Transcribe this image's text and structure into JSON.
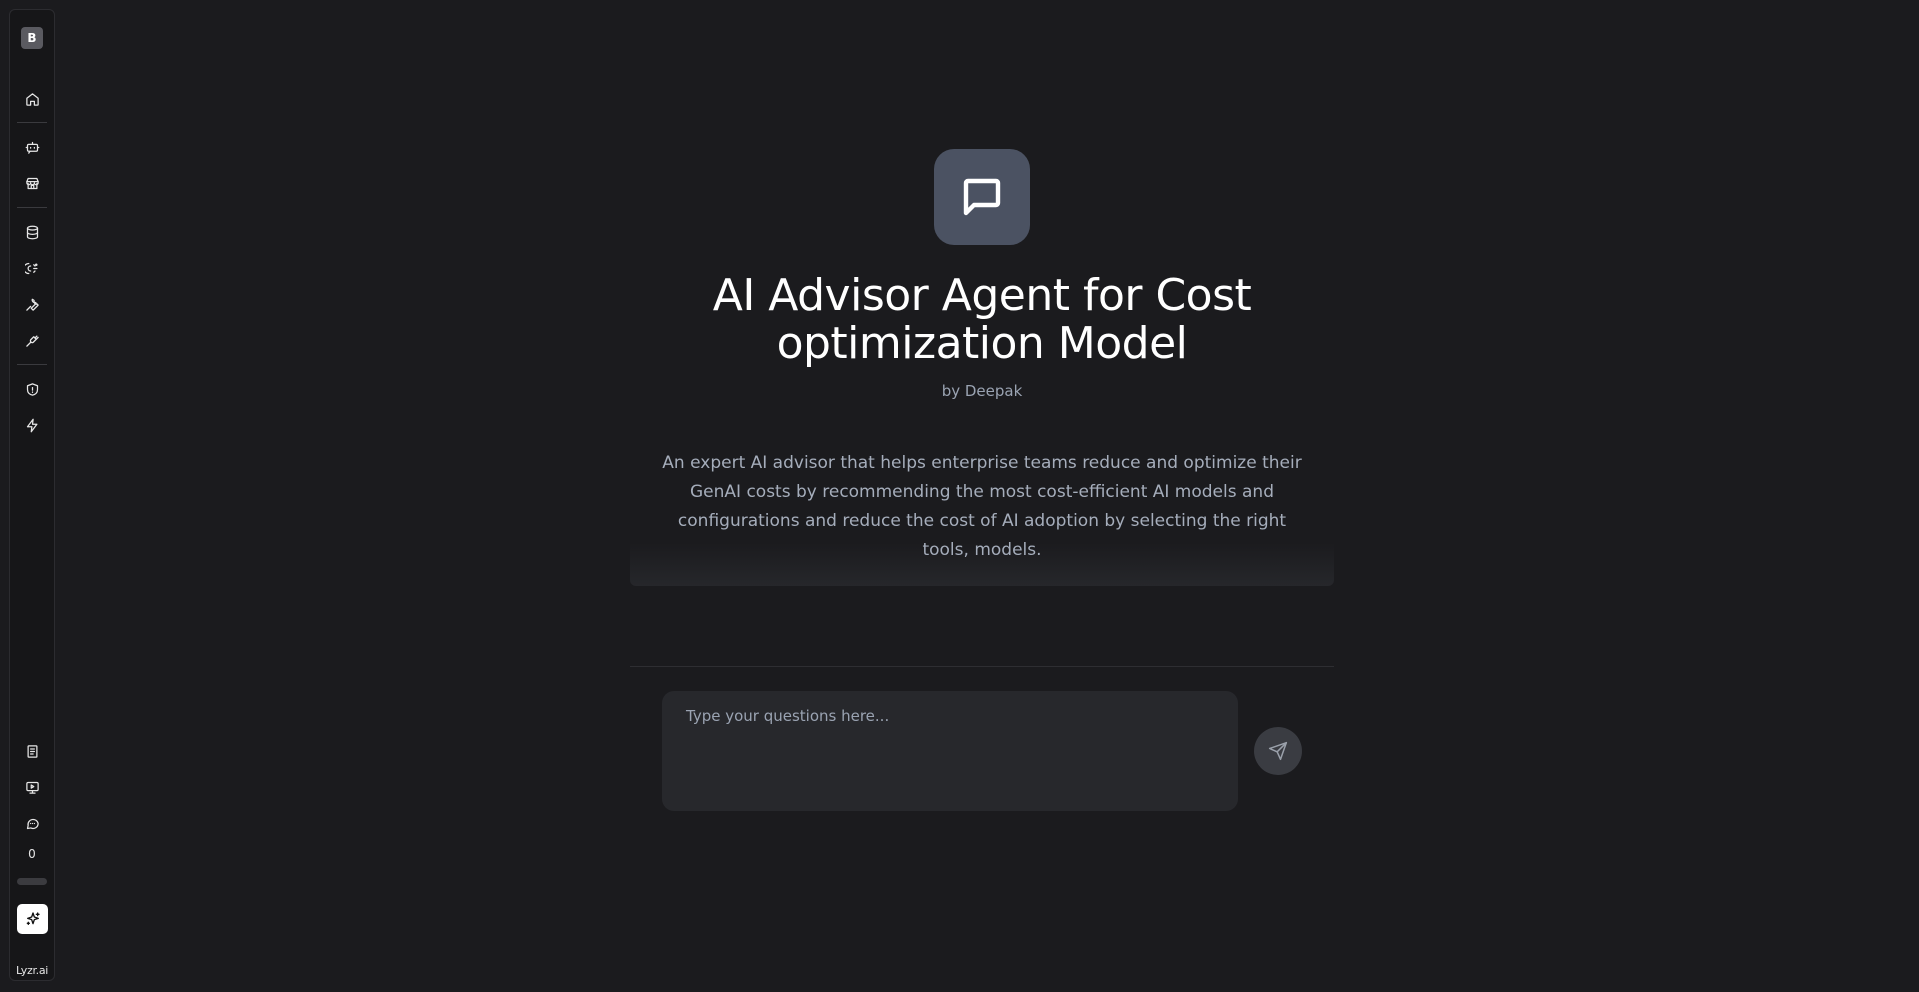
{
  "sidebar": {
    "workspace_initial": "B",
    "credits": "0",
    "credits_usage_fraction": 0,
    "brand": "Lyzr.ai",
    "icons": {
      "home": "home-icon",
      "agent_builder": "bot-icon",
      "marketplace": "store-icon",
      "knowledge_base": "database-icon",
      "voice": "voice-icon",
      "tools": "wrench-icon",
      "integrations": "plug-icon",
      "safety": "shield-icon",
      "workflows": "lightning-icon",
      "docs": "document-icon",
      "tutorials": "monitor-play-icon",
      "feedback": "chat-icon",
      "ai_assist": "sparkle-icon"
    }
  },
  "agent": {
    "icon": "message-square-icon",
    "title": "AI Advisor Agent for Cost optimization Model",
    "author": "by Deepak",
    "description": "An expert AI advisor that helps enterprise teams reduce and optimize their GenAI costs by recommending the most cost-efficient AI models and configurations and reduce the cost of AI adoption by selecting the right tools, models."
  },
  "chat": {
    "placeholder": "Type your questions here...",
    "send_icon": "send-icon"
  },
  "colors": {
    "background": "#1b1b1e",
    "sidebar_bg": "#161618",
    "agent_icon_bg": "#4b5262",
    "input_bg": "#27282c",
    "muted_text": "#9aa3b2"
  }
}
